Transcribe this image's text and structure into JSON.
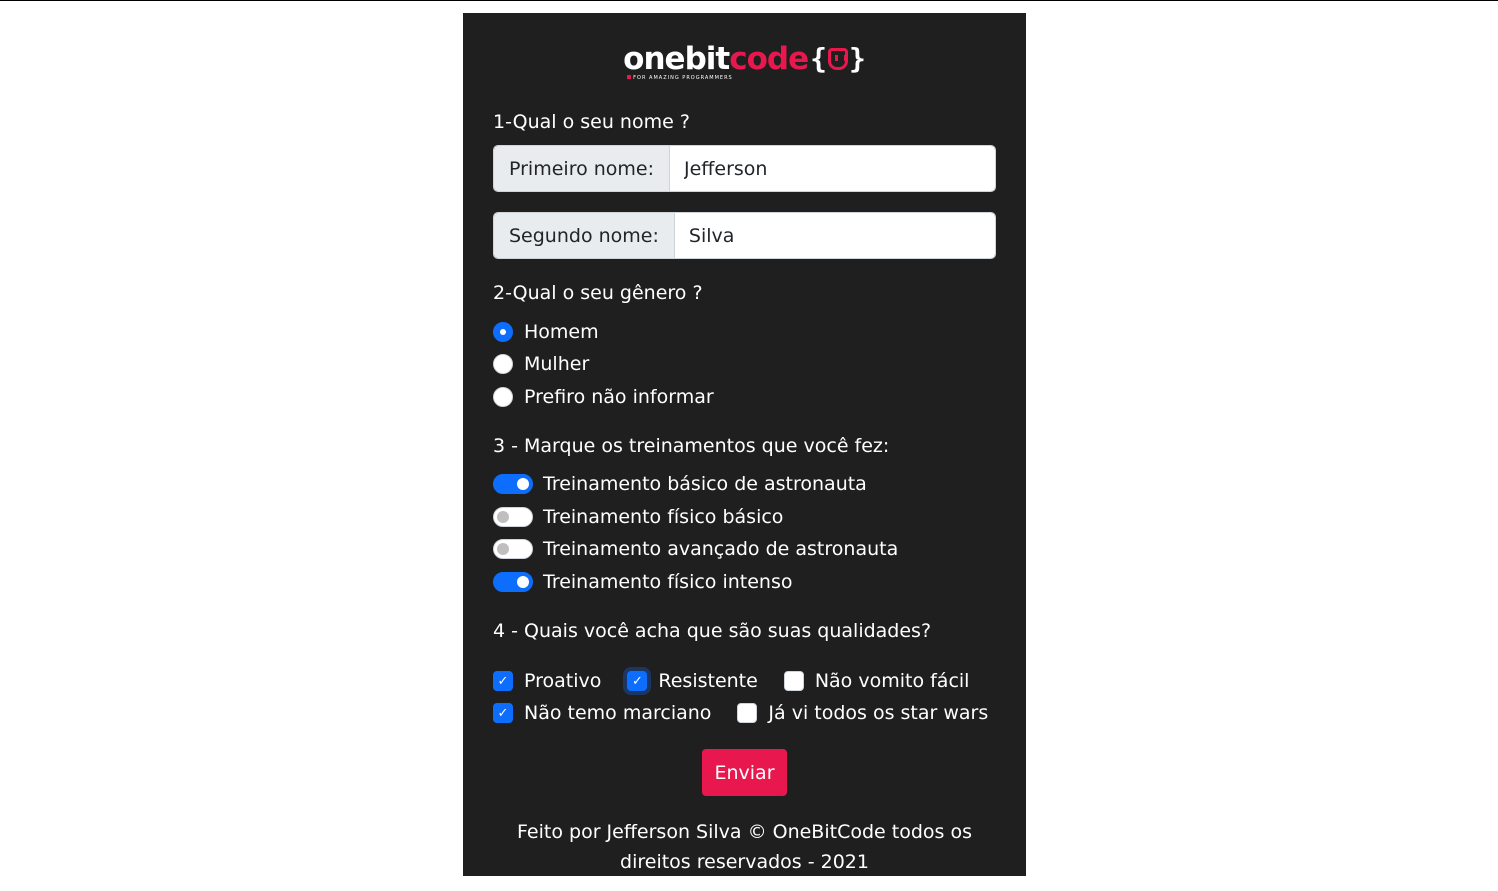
{
  "logo": {
    "one": "onebit",
    "code": "code",
    "brace_open": "{",
    "brace_close": "}",
    "tagline": "FOR AMAZING PROGRAMMERS"
  },
  "q1": {
    "title": "1-Qual o seu nome ?",
    "first_label": "Primeiro nome:",
    "first_value": "Jefferson",
    "second_label": "Segundo nome:",
    "second_value": "Silva"
  },
  "q2": {
    "title": "2-Qual o seu gênero ?",
    "options": [
      {
        "label": "Homem",
        "selected": true
      },
      {
        "label": "Mulher",
        "selected": false
      },
      {
        "label": "Prefiro não informar",
        "selected": false
      }
    ]
  },
  "q3": {
    "title": "3 - Marque os treinamentos que você fez:",
    "switches": [
      {
        "label": "Treinamento básico de astronauta",
        "on": true
      },
      {
        "label": "Treinamento físico básico",
        "on": false
      },
      {
        "label": "Treinamento avançado de astronauta",
        "on": false
      },
      {
        "label": "Treinamento físico intenso",
        "on": true
      }
    ]
  },
  "q4": {
    "title": "4 - Quais você acha que são suas qualidades?",
    "checks": [
      {
        "label": "Proativo",
        "checked": true
      },
      {
        "label": "Resistente",
        "checked": true
      },
      {
        "label": "Não vomito fácil",
        "checked": false
      },
      {
        "label": "Não temo marciano",
        "checked": true
      },
      {
        "label": "Já vi todos os star wars",
        "checked": false
      }
    ]
  },
  "submit_label": "Enviar",
  "footer": "Feito por Jefferson Silva © OneBitCode todos os direitos reservados - 2021",
  "colors": {
    "accent": "#e8184e",
    "primary": "#0d6efd",
    "panel": "#201f1f"
  },
  "icons": {
    "check": "✓"
  }
}
